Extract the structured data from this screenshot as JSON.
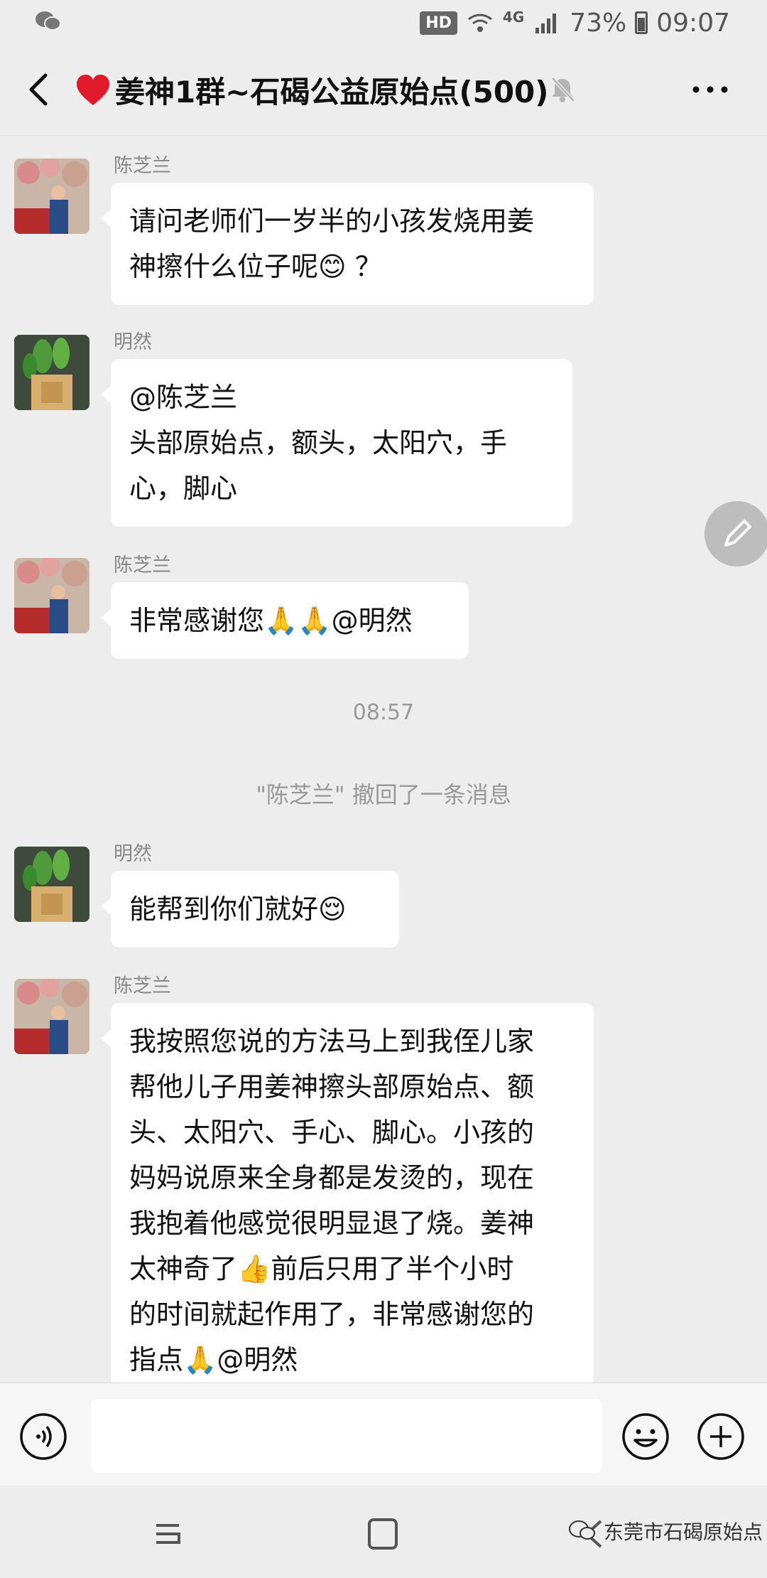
{
  "status_bar": {
    "hd": "HD",
    "network": "4G",
    "battery_percent": "73%",
    "time": "09:07"
  },
  "header": {
    "title": "姜神1群~石碣公益原始点(500)",
    "back_icon": "chevron-left-icon",
    "mute_icon": "bell-mute-icon",
    "more_icon": "more-dots-icon"
  },
  "messages": [
    {
      "sender": "陈芝兰",
      "text": "请问老师们一岁半的小孩发烧用姜\n神擦什么位子呢😊 ？"
    },
    {
      "sender": "明然",
      "text": "@陈芝兰\n头部原始点，额头，太阳穴，手\n心，脚心"
    },
    {
      "sender": "陈芝兰",
      "text": "非常感谢您🙏🙏@明然"
    },
    {
      "sender": "明然",
      "text": "能帮到你们就好😌"
    },
    {
      "sender": "陈芝兰",
      "text": "我按照您说的方法马上到我侄儿家\n帮他儿子用姜神擦头部原始点、额\n头、太阳穴、手心、脚心。小孩的\n妈妈说原来全身都是发烫的，现在\n我抱着他感觉很明显退了烧。姜神\n太神奇了👍前后只用了半个小时\n的时间就起作用了，非常感谢您的\n指点🙏@明然"
    }
  ],
  "timestamp": "08:57",
  "system_note": "\"陈芝兰\" 撤回了一条消息",
  "input_bar": {
    "placeholder": "",
    "voice_icon": "voice-icon",
    "emoji_icon": "emoji-icon",
    "plus_icon": "plus-icon"
  },
  "watermark": "东莞市石碣原始点",
  "colors": {
    "background": "#ededed",
    "bubble": "#ffffff",
    "muted_text": "#888888"
  }
}
